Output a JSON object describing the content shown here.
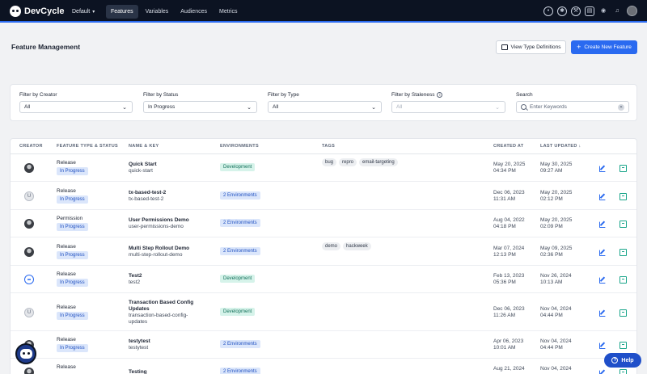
{
  "nav": {
    "brand": "DevCycle",
    "project": "Default",
    "tabs": [
      {
        "label": "Features",
        "active": true
      },
      {
        "label": "Variables",
        "active": false
      },
      {
        "label": "Audiences",
        "active": false
      },
      {
        "label": "Metrics",
        "active": false
      }
    ],
    "icons": [
      "target-icon",
      "gear-icon",
      "wrench-icon",
      "book-icon",
      "discord-icon",
      "bell-icon",
      "user-avatar"
    ]
  },
  "header": {
    "title": "Feature Management",
    "view_types_label": "View Type Definitions",
    "create_label": "Create New Feature"
  },
  "filters": {
    "creator": {
      "label": "Filter by Creator",
      "value": "All"
    },
    "status": {
      "label": "Filter by Status",
      "value": "In Progress"
    },
    "type": {
      "label": "Filter by Type",
      "value": "All"
    },
    "staleness": {
      "label": "Filter by Staleness",
      "value": "All"
    },
    "search": {
      "label": "Search",
      "placeholder": "Enter Keywords"
    }
  },
  "table": {
    "headers": {
      "creator": "CREATOR",
      "type_status": "FEATURE TYPE & STATUS",
      "name_key": "NAME & KEY",
      "environments": "ENVIRONMENTS",
      "tags": "TAGS",
      "created": "CREATED AT",
      "updated": "LAST UPDATED"
    },
    "rows": [
      {
        "creator": "photo",
        "type": "Release",
        "status": "In Progress",
        "name": "Quick Start",
        "key": "quick-start",
        "env": "Development",
        "env_kind": "dev",
        "tags": [
          "bug",
          "repro",
          "email-targeting"
        ],
        "created_date": "May 20, 2025",
        "created_time": "04:34 PM",
        "updated_date": "May 30, 2025",
        "updated_time": "09:27 AM"
      },
      {
        "creator": "U",
        "type": "Release",
        "status": "In Progress",
        "name": "tx-based-test-2",
        "key": "tx-based-test-2",
        "env": "2 Environments",
        "env_kind": "multi",
        "tags": [],
        "created_date": "Dec 06, 2023",
        "created_time": "11:31 AM",
        "updated_date": "May 20, 2025",
        "updated_time": "02:12 PM"
      },
      {
        "creator": "photo",
        "type": "Permission",
        "status": "In Progress",
        "name": "User Permissions Demo",
        "key": "user-permissions-demo",
        "env": "2 Environments",
        "env_kind": "multi",
        "tags": [],
        "created_date": "Aug 04, 2022",
        "created_time": "04:18 PM",
        "updated_date": "May 20, 2025",
        "updated_time": "02:09 PM"
      },
      {
        "creator": "photo",
        "type": "Release",
        "status": "In Progress",
        "name": "Multi Step Rollout Demo",
        "key": "multi-step-rollout-demo",
        "env": "2 Environments",
        "env_kind": "multi",
        "tags": [
          "demo",
          "hackweek"
        ],
        "created_date": "Mar 07, 2024",
        "created_time": "12:13 PM",
        "updated_date": "May 09, 2025",
        "updated_time": "02:36 PM"
      },
      {
        "creator": "bot",
        "type": "Release",
        "status": "In Progress",
        "name": "Test2",
        "key": "test2",
        "env": "Development",
        "env_kind": "dev",
        "tags": [],
        "created_date": "Feb 13, 2023",
        "created_time": "05:36 PM",
        "updated_date": "Nov 26, 2024",
        "updated_time": "10:13 AM"
      },
      {
        "creator": "U",
        "type": "Release",
        "status": "In Progress",
        "name": "Transaction Based Config Updates",
        "key": "transaction-based-config-updates",
        "env": "Development",
        "env_kind": "dev",
        "tags": [],
        "created_date": "Dec 06, 2023",
        "created_time": "11:26 AM",
        "updated_date": "Nov 04, 2024",
        "updated_time": "04:44 PM"
      },
      {
        "creator": "photo",
        "type": "Release",
        "status": "In Progress",
        "name": "testytest",
        "key": "testytest",
        "env": "2 Environments",
        "env_kind": "multi",
        "tags": [],
        "created_date": "Apr 06, 2023",
        "created_time": "10:01 AM",
        "updated_date": "Nov 04, 2024",
        "updated_time": "04:44 PM"
      },
      {
        "creator": "photo",
        "type": "Release",
        "status": "",
        "name": "Testing",
        "key": "",
        "env": "2 Environments",
        "env_kind": "multi",
        "tags": [],
        "created_date": "Aug 21, 2024",
        "created_time": "",
        "updated_date": "Nov 04, 2024",
        "updated_time": ""
      }
    ]
  },
  "help_label": "Help",
  "colors": {
    "brand": "#2a6af0",
    "nav_bg": "#0c1322",
    "dev_badge": "#d6f3ea",
    "status_badge": "#dbe6fb"
  }
}
